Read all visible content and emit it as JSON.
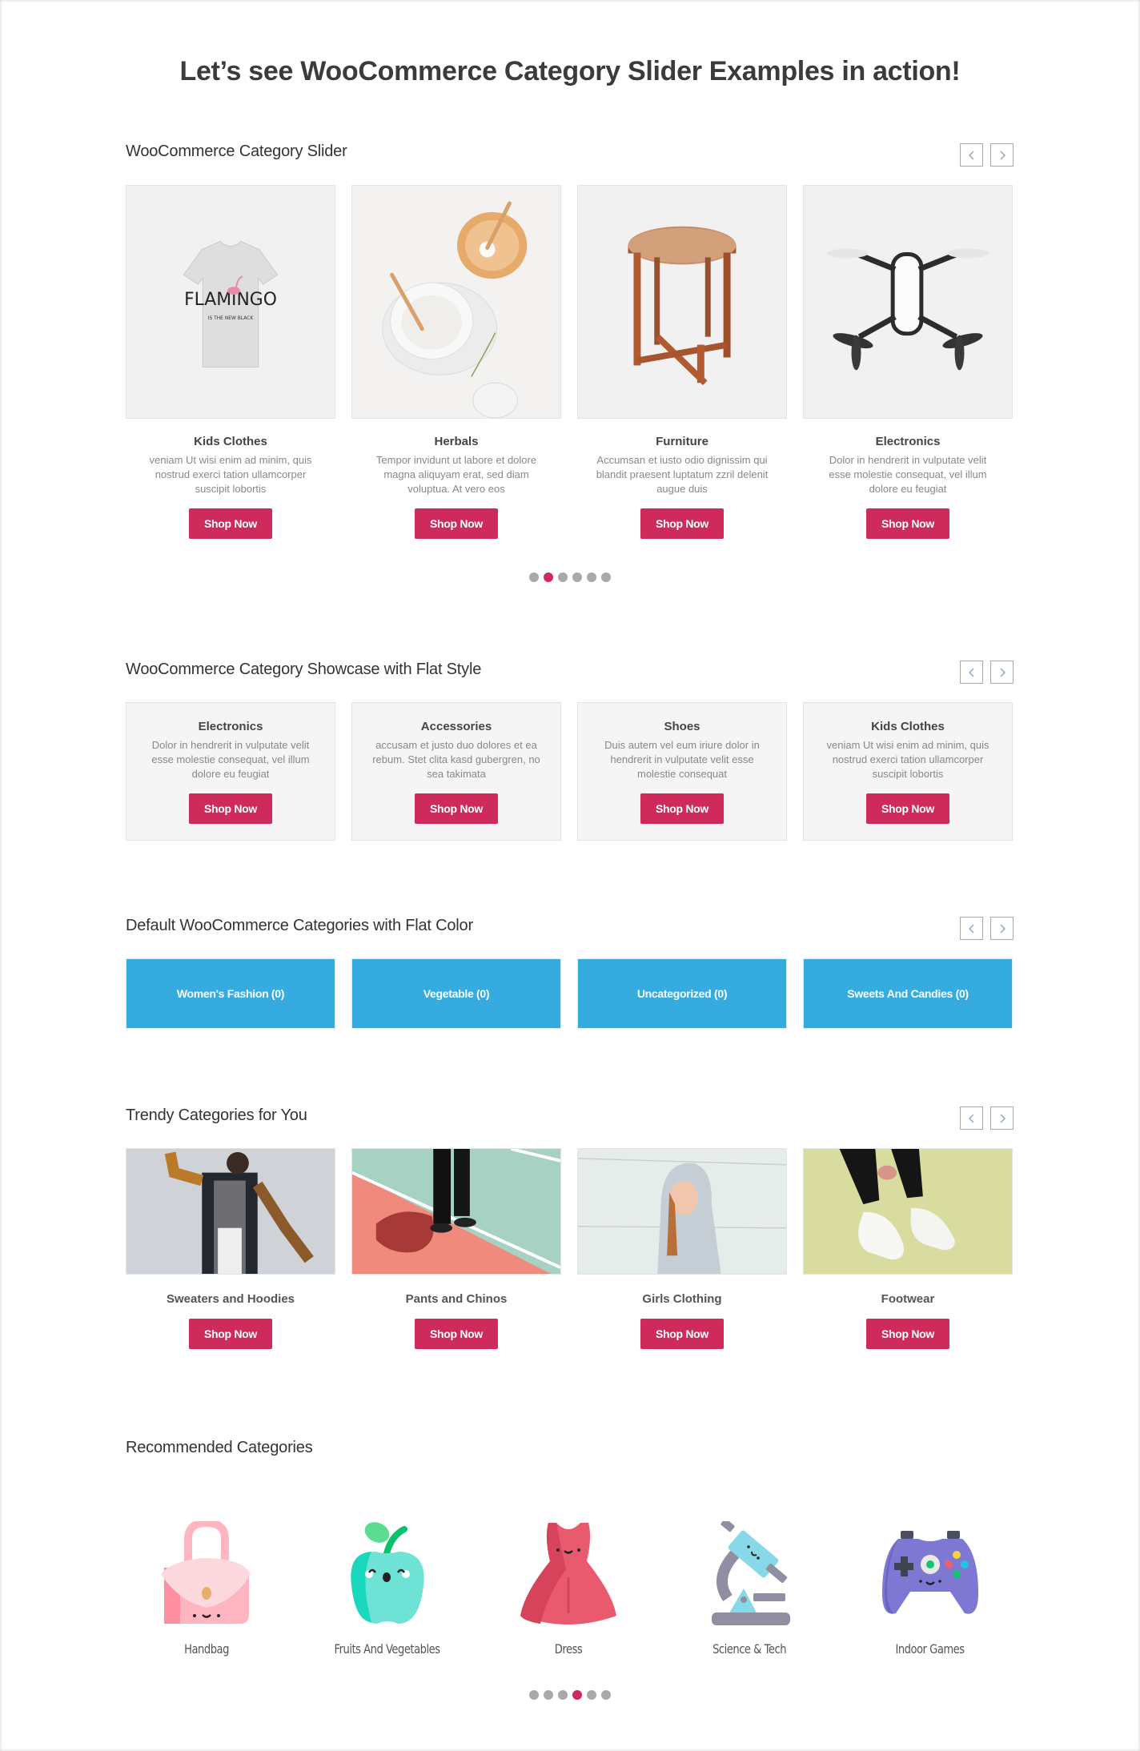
{
  "page": {
    "title": "Let’s see WooCommerce Category Slider Examples in action!"
  },
  "colors": {
    "accent": "#cf2a5c",
    "tile_blue": "#35abdf",
    "dot_inactive": "#a9a9a9"
  },
  "nav": {
    "prev_icon": "chevron-left-icon",
    "next_icon": "chevron-right-icon"
  },
  "slider": {
    "title": "WooCommerce Category Slider",
    "items": [
      {
        "name": "Kids Clothes",
        "desc": "veniam Ut wisi enim ad minim, quis nostrud exerci tation ullamcorper suscipit lobortis",
        "button": "Shop Now",
        "image": "flamingo-tshirt"
      },
      {
        "name": "Herbals",
        "desc": "Tempor invidunt ut labore et dolore magna aliquyam erat, sed diam voluptua. At vero eos",
        "button": "Shop Now",
        "image": "salt-bowls"
      },
      {
        "name": "Furniture",
        "desc": "Accumsan et iusto odio dignissim qui blandit praesent luptatum zzril delenit augue duis",
        "button": "Shop Now",
        "image": "wooden-stool"
      },
      {
        "name": "Electronics",
        "desc": "Dolor in hendrerit in vulputate velit esse molestie consequat, vel illum dolore eu feugiat",
        "button": "Shop Now",
        "image": "drone"
      }
    ],
    "pagination": {
      "total": 6,
      "active": 2
    }
  },
  "showcase": {
    "title": "WooCommerce Category Showcase with Flat Style",
    "items": [
      {
        "name": "Electronics",
        "desc": "Dolor in hendrerit in vulputate velit esse molestie consequat, vel illum dolore eu feugiat",
        "button": "Shop Now"
      },
      {
        "name": "Accessories",
        "desc": "accusam et justo duo dolores et ea rebum. Stet clita kasd gubergren, no sea takimata",
        "button": "Shop Now"
      },
      {
        "name": "Shoes",
        "desc": "Duis autem vel eum iriure dolor in hendrerit in vulputate velit esse molestie consequat",
        "button": "Shop Now"
      },
      {
        "name": "Kids Clothes",
        "desc": "veniam Ut wisi enim ad minim, quis nostrud exerci tation ullamcorper suscipit lobortis",
        "button": "Shop Now"
      }
    ]
  },
  "flat_color": {
    "title": "Default WooCommerce Categories with Flat Color",
    "items": [
      {
        "label": "Women's Fashion (0)"
      },
      {
        "label": "Vegetable (0)"
      },
      {
        "label": "Uncategorized (0)"
      },
      {
        "label": "Sweets And Candies (0)"
      }
    ]
  },
  "trendy": {
    "title": "Trendy Categories for You",
    "items": [
      {
        "name": "Sweaters and Hoodies",
        "button": "Shop Now",
        "image": "man-in-hoodie"
      },
      {
        "name": "Pants and Chinos",
        "button": "Shop Now",
        "image": "legs-on-court"
      },
      {
        "name": "Girls Clothing",
        "button": "Shop Now",
        "image": "girl-in-hoodie"
      },
      {
        "name": "Footwear",
        "button": "Shop Now",
        "image": "white-sneakers"
      }
    ]
  },
  "recommended": {
    "title": "Recommended Categories",
    "items": [
      {
        "label": "Handbag",
        "icon": "handbag-icon"
      },
      {
        "label": "Fruits And Vegetables",
        "icon": "apple-icon"
      },
      {
        "label": "Dress",
        "icon": "dress-icon"
      },
      {
        "label": "Science & Tech",
        "icon": "microscope-icon"
      },
      {
        "label": "Indoor Games",
        "icon": "gamepad-icon"
      }
    ],
    "pagination": {
      "total": 6,
      "active": 4
    }
  }
}
